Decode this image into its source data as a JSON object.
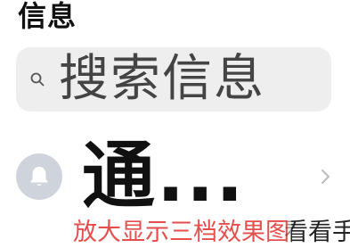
{
  "header": {
    "title": "信息"
  },
  "search": {
    "placeholder": "搜索信息",
    "icon": "search-icon"
  },
  "list": {
    "items": [
      {
        "title": "通...",
        "avatar_icon": "bell-icon",
        "chevron_icon": "chevron-right-icon"
      }
    ]
  },
  "watermark": {
    "caption": "放大显示三档效果图",
    "brand": "看看手游网"
  },
  "colors": {
    "search_bg": "#eeeeee",
    "avatar_bg": "#cfd4dc",
    "watermark_red": "#e0302e"
  }
}
